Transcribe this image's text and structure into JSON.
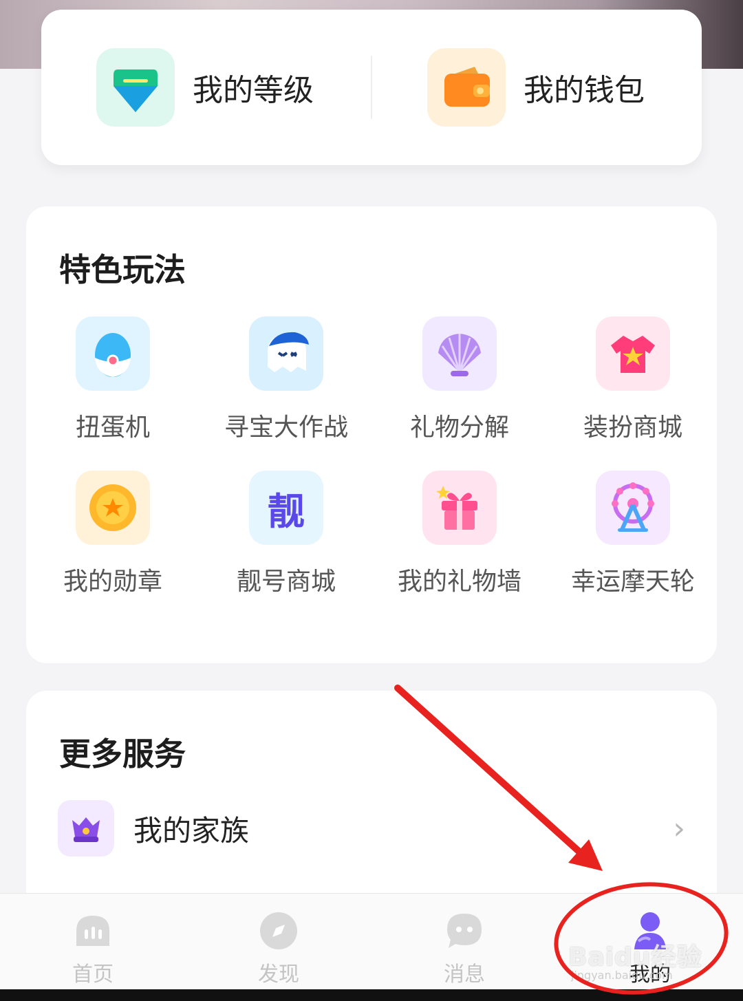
{
  "top_card": {
    "level_label": "我的等级",
    "wallet_label": "我的钱包"
  },
  "features": {
    "title": "特色玩法",
    "items": [
      {
        "label": "扭蛋机",
        "icon": "gacha-egg-icon"
      },
      {
        "label": "寻宝大作战",
        "icon": "treasure-hunt-icon"
      },
      {
        "label": "礼物分解",
        "icon": "shell-icon"
      },
      {
        "label": "装扮商城",
        "icon": "shirt-star-icon"
      },
      {
        "label": "我的勋章",
        "icon": "medal-icon"
      },
      {
        "label": "靓号商城",
        "icon": "pretty-number-icon",
        "glyph": "靓"
      },
      {
        "label": "我的礼物墙",
        "icon": "gift-icon"
      },
      {
        "label": "幸运摩天轮",
        "icon": "ferris-wheel-icon"
      }
    ]
  },
  "services": {
    "title": "更多服务",
    "items": [
      {
        "label": "我的家族",
        "icon": "family-crown-icon"
      }
    ]
  },
  "tabbar": {
    "tabs": [
      {
        "label": "首页",
        "icon": "home-icon",
        "active": false
      },
      {
        "label": "发现",
        "icon": "compass-icon",
        "active": false
      },
      {
        "label": "消息",
        "icon": "chat-icon",
        "active": false
      },
      {
        "label": "我的",
        "icon": "profile-icon",
        "active": true
      }
    ]
  },
  "watermark": {
    "text": "Baidu经验",
    "sub": "jingyan.baidu.com"
  },
  "colors": {
    "accent": "#7b5cf5",
    "annotation": "#e8231f"
  }
}
